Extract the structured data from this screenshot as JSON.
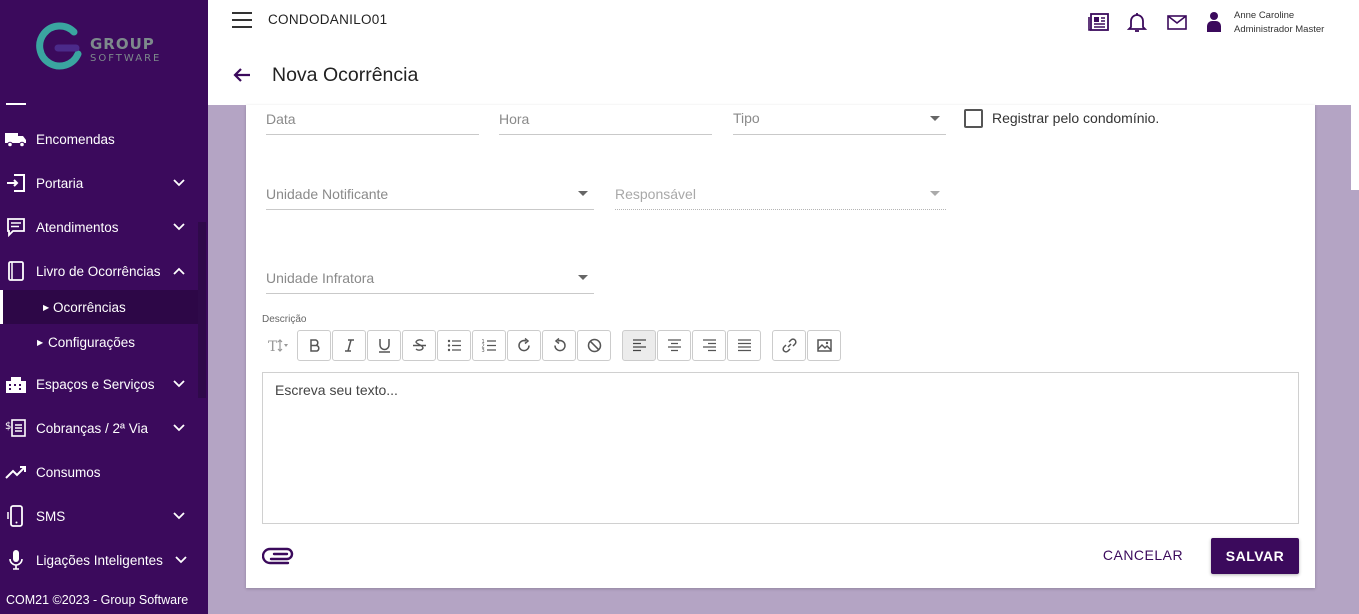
{
  "sidebar": {
    "logo": {
      "line1": "GROUP",
      "line2": "SOFTWARE"
    },
    "items": [
      {
        "label": "Encomendas",
        "icon": "truck-icon",
        "expand": "none"
      },
      {
        "label": "Portaria",
        "icon": "door-enter-icon",
        "expand": "down"
      },
      {
        "label": "Atendimentos",
        "icon": "chat-icon",
        "expand": "down"
      },
      {
        "label": "Livro de Ocorrências",
        "icon": "book-icon",
        "expand": "up"
      },
      {
        "label": "Espaços e Serviços",
        "icon": "building-icon",
        "expand": "down"
      },
      {
        "label": "Cobranças / 2ª Via",
        "icon": "bill-icon",
        "expand": "down"
      },
      {
        "label": "Consumos",
        "icon": "trend-icon",
        "expand": "none"
      },
      {
        "label": "SMS",
        "icon": "phone-icon",
        "expand": "down"
      },
      {
        "label": "Ligações Inteligentes",
        "icon": "microphone-icon",
        "expand": "down"
      }
    ],
    "subitems": [
      {
        "label": "Ocorrências",
        "active": true
      },
      {
        "label": "Configurações",
        "active": false
      }
    ],
    "footer": "COM21 ©2023 - Group Software"
  },
  "header": {
    "condo": "CONDODANILO01",
    "user_name": "Anne Caroline",
    "user_role": "Administrador Master",
    "page_title": "Nova Ocorrência"
  },
  "form": {
    "data_placeholder": "Data",
    "hora_placeholder": "Hora",
    "tipo_placeholder": "Tipo",
    "registrar_label": "Registrar pelo condomínio.",
    "registrar_checked": false,
    "unidade_notificante_placeholder": "Unidade Notificante",
    "responsavel_placeholder": "Responsável",
    "unidade_infratora_placeholder": "Unidade Infratora",
    "descricao_label": "Descrição",
    "editor_placeholder": "Escreva seu texto...",
    "cancel_label": "CANCELAR",
    "save_label": "SALVAR"
  },
  "colors": {
    "primary": "#3b0a5c",
    "background": "#b4a4c4"
  }
}
